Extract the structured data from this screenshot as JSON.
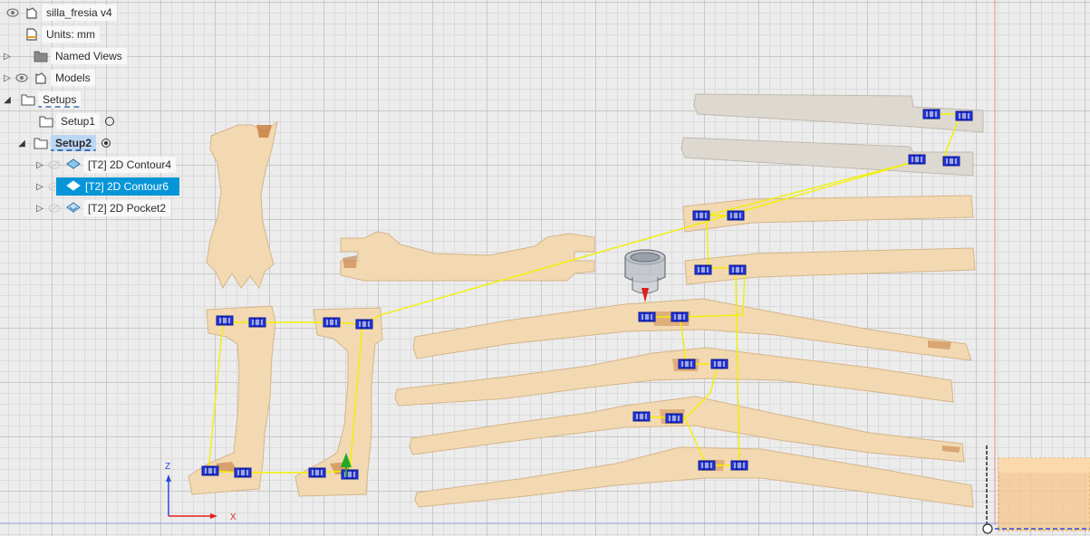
{
  "browser": {
    "document_name": "silla_fresia v4",
    "units": "Units: mm",
    "named_views": "Named Views",
    "models": "Models",
    "setups": "Setups",
    "setup1": "Setup1",
    "setup2": "Setup2",
    "operations": [
      {
        "label": "[T2] 2D Contour4",
        "icon": "contour-icon",
        "selected": false
      },
      {
        "label": "[T2] 2D Contour6",
        "icon": "contour-icon",
        "selected": true
      },
      {
        "label": "[T2] 2D Pocket2",
        "icon": "pocket-icon",
        "selected": false
      }
    ]
  },
  "viewcube": {
    "x_axis": "X",
    "z_axis": "Z"
  },
  "colors": {
    "wood": "#f2d9b2",
    "wood_edge": "#d8b88e",
    "gray_part": "#ddd8d0",
    "toolpath": "#f2f000",
    "clamp": "#1f2fd8",
    "selection": "#0696d7",
    "stock_box": "#f7c68a"
  }
}
